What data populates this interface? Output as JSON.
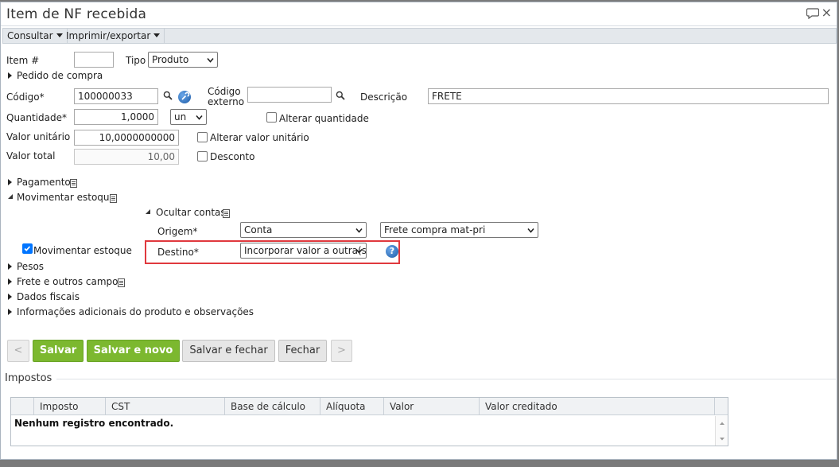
{
  "window": {
    "title": "Item de NF recebida"
  },
  "toolbar": {
    "consultar": "Consultar",
    "imprimir": "Imprimir/exportar"
  },
  "form": {
    "item_label": "Item #",
    "item_value": "",
    "tipo_label": "Tipo",
    "tipo_value": "Produto",
    "pedido_compra": "Pedido de compra",
    "codigo_label": "Código*",
    "codigo_value": "100000033",
    "codigo_externo_label_1": "Código",
    "codigo_externo_label_2": "externo",
    "codigo_externo_value": "",
    "descricao_label": "Descrição",
    "descricao_value": "FRETE",
    "quantidade_label": "Quantidade*",
    "quantidade_value": "1,0000",
    "unidade_value": "un",
    "alterar_quantidade": "Alterar quantidade",
    "valor_unitario_label": "Valor unitário",
    "valor_unitario_value": "10,0000000000",
    "alterar_valor_unitario": "Alterar valor unitário",
    "valor_total_label": "Valor total",
    "valor_total_value": "10,00",
    "desconto": "Desconto"
  },
  "sections": {
    "pagamento": "Pagamento",
    "movimentar_estoque": "Movimentar estoque",
    "ocultar_contas": "Ocultar contas",
    "origem_label": "Origem*",
    "origem_tipo": "Conta",
    "origem_conta": "Frete compra mat-pri",
    "destino_label": "Destino*",
    "destino_value": "Incorporar valor a outra(s",
    "movimentar_estoque_check": "Movimentar estoque",
    "pesos": "Pesos",
    "frete_outros": "Frete e outros campos",
    "dados_fiscais": "Dados fiscais",
    "info_adicionais": "Informações adicionais do produto e observações"
  },
  "buttons": {
    "prev": "<",
    "salvar": "Salvar",
    "salvar_novo": "Salvar e novo",
    "salvar_fechar": "Salvar e fechar",
    "fechar": "Fechar",
    "next": ">"
  },
  "impostos": {
    "title": "Impostos",
    "columns": [
      "Imposto",
      "CST",
      "Base de cálculo",
      "Alíquota",
      "Valor",
      "Valor creditado"
    ],
    "empty_message": "Nenhum registro encontrado."
  },
  "colors": {
    "green": "#7cb82f",
    "highlight": "#e0393e",
    "help": "#1d5ca8"
  }
}
